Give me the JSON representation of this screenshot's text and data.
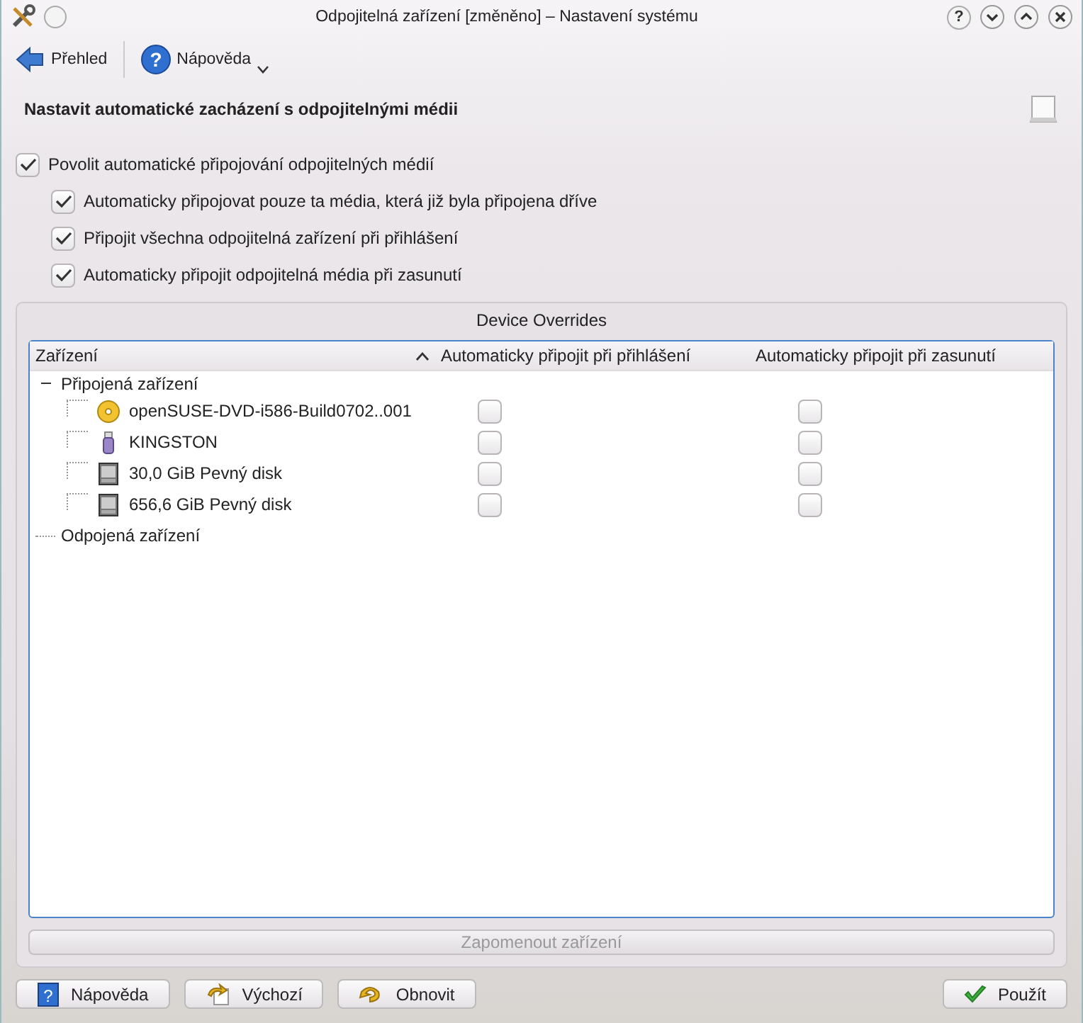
{
  "window": {
    "title": "Odpojitelná zařízení [změněno] – Nastavení systému",
    "help_button": "?"
  },
  "toolbar": [
    {
      "label": "Přehled",
      "kind": "back"
    },
    {
      "label": "Nápověda",
      "kind": "help",
      "icon_text": "?"
    }
  ],
  "heading": "Nastavit automatické zacházení s odpojitelnými médii",
  "options": [
    {
      "label": "Povolit automatické připojování odpojitelných médií",
      "checked": true,
      "indent": false
    },
    {
      "label": "Automaticky připojovat pouze ta média, která již byla připojena dříve",
      "checked": true,
      "indent": true
    },
    {
      "label": "Připojit všechna odpojitelná zařízení při přihlášení",
      "checked": true,
      "indent": true
    },
    {
      "label": "Automaticky připojit odpojitelná média při zasunutí",
      "checked": true,
      "indent": true
    }
  ],
  "group": {
    "title": "Device Overrides",
    "columns": [
      "Zařízení",
      "Automaticky připojit při přihlášení",
      "Automaticky připojit při zasunutí"
    ],
    "tree": [
      {
        "label": "Připojená zařízení",
        "expanded": true,
        "children": [
          {
            "label": "openSUSE-DVD-i586-Build0702..001",
            "kind": "dvd",
            "login": false,
            "insert": false
          },
          {
            "label": "KINGSTON",
            "kind": "usb",
            "login": false,
            "insert": false
          },
          {
            "label": "30,0 GiB Pevný disk",
            "kind": "disk",
            "login": false,
            "insert": false
          },
          {
            "label": "656,6 GiB Pevný disk",
            "kind": "disk",
            "login": false,
            "insert": false
          }
        ]
      },
      {
        "label": "Odpojená zařízení",
        "expanded": false
      }
    ],
    "forget_button": {
      "label": "Zapomenout zařízení",
      "disabled": true
    }
  },
  "buttons": [
    {
      "label": "Nápověda",
      "kind": "help",
      "icon_text": "?"
    },
    {
      "label": "Výchozí",
      "kind": "defaults"
    },
    {
      "label": "Obnovit",
      "kind": "reset"
    },
    {
      "label": "Použít",
      "kind": "apply"
    }
  ]
}
